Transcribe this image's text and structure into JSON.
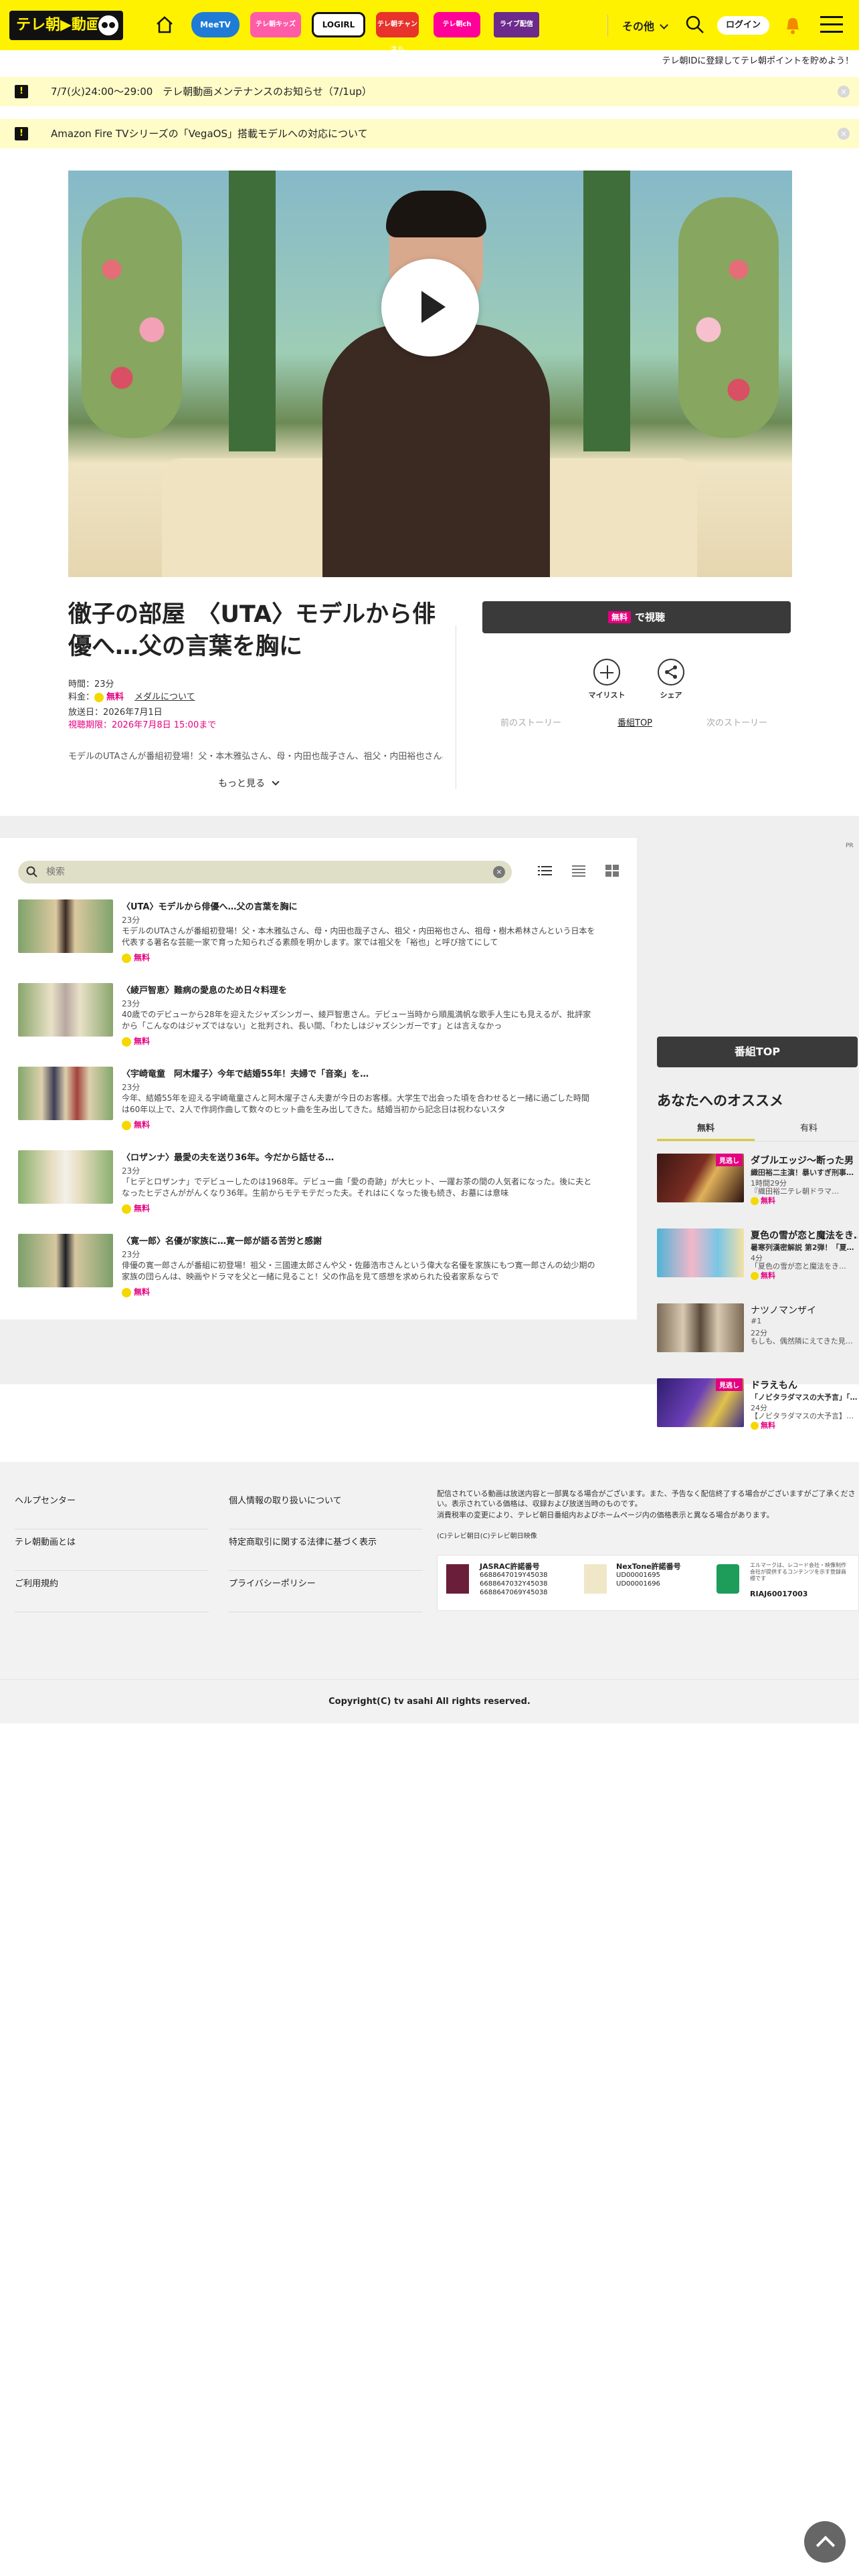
{
  "header": {
    "logo": "テレ朝▶動画",
    "nav_logos": [
      "MeeTV",
      "テレ朝キッズ",
      "LOGIRL",
      "テレ朝チャンネル",
      "テレ朝ch",
      "ライブ配信"
    ],
    "more_label": "その他",
    "login_label": "ログイン"
  },
  "point_notice": "テレ朝IDに登録してテレ朝ポイントを貯めよう！",
  "notices": [
    "7/7(火)24:00～29:00　テレ朝動画メンテナンスのお知らせ（7/1up）",
    "Amazon Fire TVシリーズの「VegaOS」搭載モデルへの対応について"
  ],
  "program": {
    "title": "徹子の部屋　〈UTA〉モデルから俳優へ…父の言葉を胸に",
    "duration": "時間：23分",
    "price_label": "料金：",
    "price_free": "無料",
    "medal_link": "メダルについて",
    "air_date": "放送日：2026年7月1日",
    "deadline": "視聴期限：2026年7月8日 15:00まで",
    "description": "モデルのUTAさんが番組初登場！父・本木雅弘さん、母・内田也哉子さん、祖父・内田裕也さん、祖母・樹木希林さん",
    "more_label": "もっと見る",
    "watch_free_tag": "無料",
    "watch_label": "で視聴",
    "mylist_label": "マイリスト",
    "share_label": "シェア",
    "prev_story": "前のストーリー",
    "program_top": "番組TOP",
    "next_story": "次のストーリー"
  },
  "episodes": {
    "search_placeholder": "検索",
    "items": [
      {
        "title": "〈UTA〉モデルから俳優へ…父の言葉を胸に",
        "duration": "23分",
        "desc": "モデルのUTAさんが番組初登場！父・本木雅弘さん、母・内田也哉子さん、祖父・内田裕也さん、祖母・樹木希林さんという日本を代表する著名な芸能一家で育った知られざる素顔を明かします。家では祖父を「裕也」と呼び捨てにして",
        "price": "無料"
      },
      {
        "title": "〈綾戸智恵〉難病の愛息のため日々料理を",
        "duration": "23分",
        "desc": "40歳でのデビューから28年を迎えたジャズシンガー、綾戸智恵さん。デビュー当時から順風満帆な歌手人生にも見えるが、批評家から「こんなのはジャズではない」と批判され、長い間、「わたしはジャズシンガーです」とは言えなかっ",
        "price": "無料"
      },
      {
        "title": "〈宇崎竜童　阿木燿子〉今年で結婚55年！夫婦で「音楽」を…",
        "duration": "23分",
        "desc": "今年、結婚55年を迎える宇崎竜童さんと阿木燿子さん夫妻が今日のお客様。大学生で出会った頃を合わせると一緒に過ごした時間は60年以上で、2人で作詞作曲して数々のヒット曲を生み出してきた。結婚当初から記念日は祝わないスタ",
        "price": "無料"
      },
      {
        "title": "〈ロザンナ〉最愛の夫を送り36年。今だから話せる…",
        "duration": "23分",
        "desc": "「ヒデとロザンナ」でデビューしたのは1968年。デビュー曲「愛の奇跡」が大ヒット、一躍お茶の間の人気者になった。後に夫となったヒデさんががんくなり36年。生前からモテモテだった夫。それはにくなった後も続き、お墓には意味",
        "price": "無料"
      },
      {
        "title": "〈寛一郎〉名優が家族に…寛一郎が語る苦労と感謝",
        "duration": "23分",
        "desc": "俳優の寛一郎さんが番組に初登場！祖父・三國連太郎さんや父・佐藤浩市さんという偉大な名優を家族にもつ寛一郎さんの幼少期の家族の団らんは、映画やドラマを父と一緒に見ること！父の作品を見て感想を求められた役者家系ならで",
        "price": "無料"
      }
    ]
  },
  "sidebar": {
    "ad_label": "PR",
    "program_top_button": "番組TOP",
    "reco_title": "あなたへのオススメ",
    "tabs": [
      "無料",
      "有料"
    ],
    "items": [
      {
        "badge": "見逃し",
        "name": "ダブルエッジ〜断った男",
        "sub": "織田裕二主演！暴いすぎ刑事…",
        "desc": "1時間29分",
        "desc2": "『織田裕二テレ朝ドラマ…",
        "price": "無料"
      },
      {
        "badge": "",
        "name": "夏色の雪が恋と魔法をき…",
        "sub": "暑寒列漢密解説 第2弾！「夏…",
        "desc": "4分",
        "desc2": "「夏色の雪が恋と魔法をき…",
        "price": "無料"
      },
      {
        "badge": "",
        "name": "ナツノマンザイ",
        "sub": "#1",
        "desc": "22分",
        "desc2": "もしも、偶然隣にえてきた見…",
        "price": "無料"
      },
      {
        "badge": "見逃し",
        "name": "ドラえもん",
        "sub": "「ノビタラダマスの大予言」「…",
        "desc": "24分",
        "desc2": "【ノビタラダマスの大予言】…",
        "price": "無料"
      }
    ]
  },
  "footer": {
    "links_col1": [
      "ヘルプセンター",
      "テレ朝動画とは",
      "ご利用規約"
    ],
    "links_col2": [
      "個人情報の取り扱いについて",
      "特定商取引に関する法律に基づく表示",
      "プライバシーポリシー"
    ],
    "note1": "配信されている動画は放送内容と一部異なる場合がございます。また、予告なく配信終了する場合がございますがご了承ください。表示されている価格は、収録および放送当時のものです。",
    "note2": "消費税率の変更により、テレビ朝日番組内およびホームページ内の価格表示と異なる場合があります。",
    "note3": "(C)テレビ朝日(C)テレビ朝日映像",
    "jasrac_title": "JASRAC許諾番号",
    "jasrac_nums": "6688647019Y45038\n6688647032Y45038\n6688647069Y45038",
    "nextone_title": "NexTone許諾番号",
    "nextone_nums": "UD00001695\nUD00001696",
    "lmark_text": "エルマークは、レコード会社・映像制作会社が提供するコンテンツを示す登録商標です",
    "lmark_num": "RIAJ60017003",
    "copyright": "Copyright(C) tv asahi All rights reserved."
  }
}
